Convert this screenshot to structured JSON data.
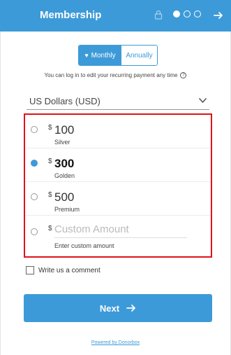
{
  "header": {
    "title": "Membership",
    "steps": [
      true,
      false,
      false
    ]
  },
  "frequency": {
    "monthly_label": "Monthly",
    "annually_label": "Annually",
    "selected": "monthly"
  },
  "info_text": "You can log in to edit your recurring payment any time",
  "currency": {
    "selected": "US Dollars (USD)"
  },
  "amounts": [
    {
      "sign": "$",
      "amount": "100",
      "tier": "Silver",
      "selected": false
    },
    {
      "sign": "$",
      "amount": "300",
      "tier": "Golden",
      "selected": true
    },
    {
      "sign": "$",
      "amount": "500",
      "tier": "Premium",
      "selected": false
    }
  ],
  "custom": {
    "sign": "$",
    "placeholder": "Custom Amount",
    "hint": "Enter custom amount"
  },
  "comment_label": "Write us a comment",
  "next_label": "Next",
  "powered_by": "Powered by Donorbox",
  "colors": {
    "accent": "#3d9ad8",
    "highlight": "#e0121b"
  }
}
